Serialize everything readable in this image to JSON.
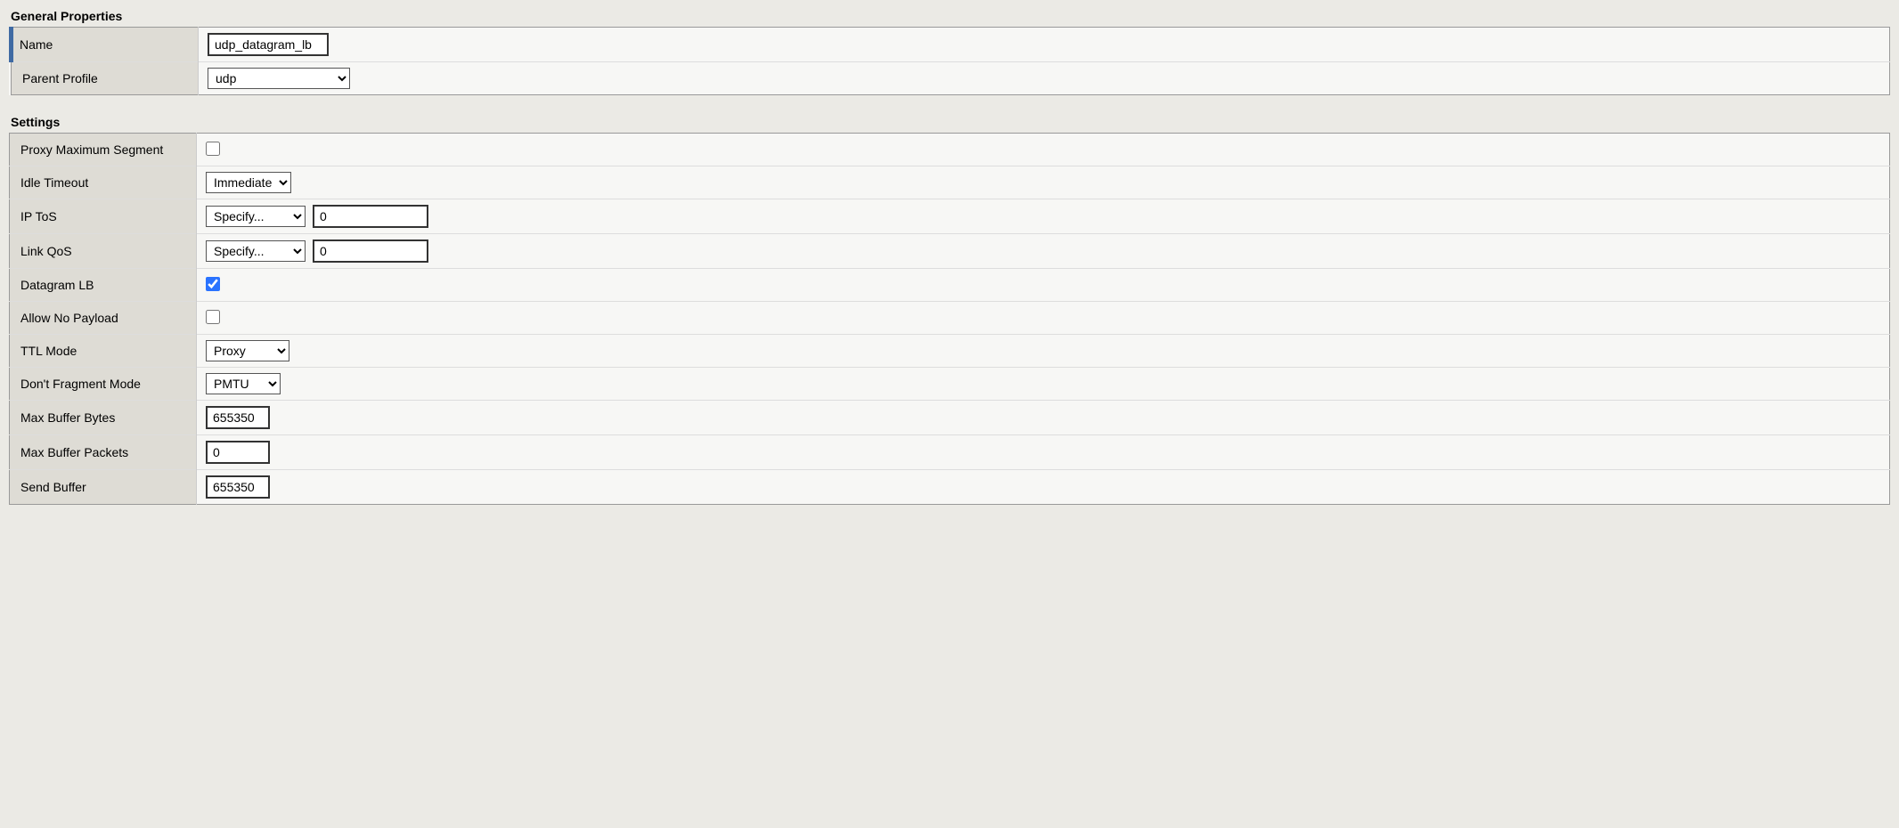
{
  "general": {
    "title": "General Properties",
    "name_label": "Name",
    "name_value": "udp_datagram_lb",
    "parent_profile_label": "Parent Profile",
    "parent_profile_value": "udp"
  },
  "settings": {
    "title": "Settings",
    "proxy_max_seg_label": "Proxy Maximum Segment",
    "proxy_max_seg_checked": false,
    "idle_timeout_label": "Idle Timeout",
    "idle_timeout_value": "Immediate",
    "ip_tos_label": "IP ToS",
    "ip_tos_mode": "Specify...",
    "ip_tos_value": "0",
    "link_qos_label": "Link QoS",
    "link_qos_mode": "Specify...",
    "link_qos_value": "0",
    "datagram_lb_label": "Datagram LB",
    "datagram_lb_checked": true,
    "allow_no_payload_label": "Allow No Payload",
    "allow_no_payload_checked": false,
    "ttl_mode_label": "TTL Mode",
    "ttl_mode_value": "Proxy",
    "dont_fragment_label": "Don't Fragment Mode",
    "dont_fragment_value": "PMTU",
    "max_buffer_bytes_label": "Max Buffer Bytes",
    "max_buffer_bytes_value": "655350",
    "max_buffer_packets_label": "Max Buffer Packets",
    "max_buffer_packets_value": "0",
    "send_buffer_label": "Send Buffer",
    "send_buffer_value": "655350"
  }
}
